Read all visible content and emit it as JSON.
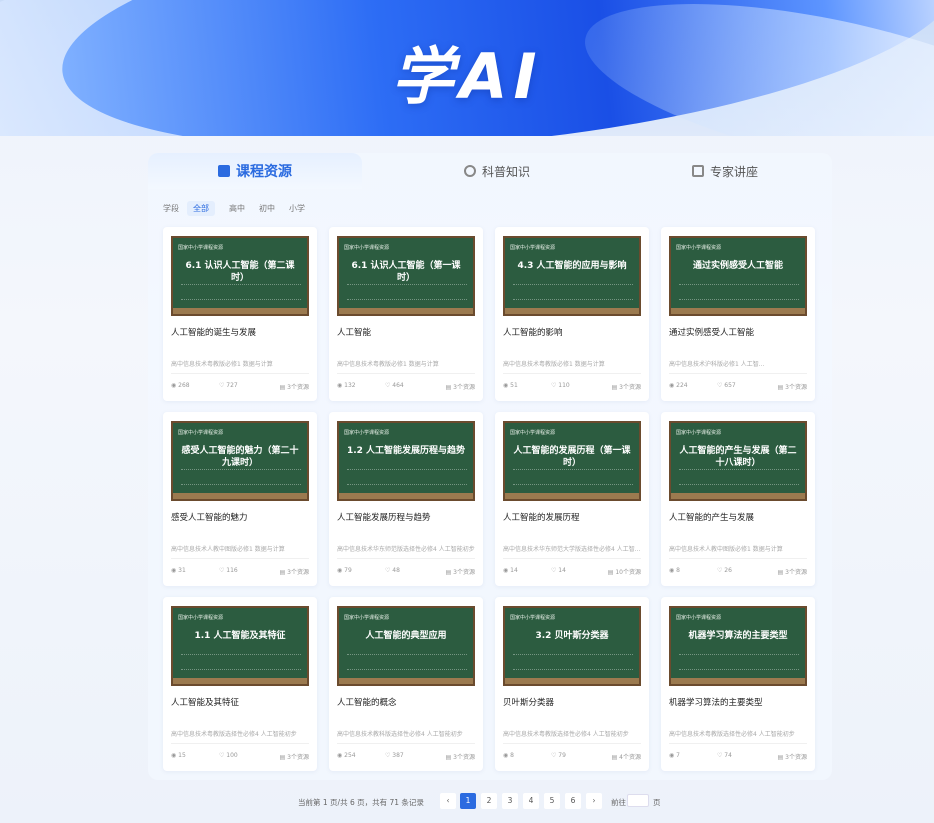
{
  "header": {
    "title": "学AI"
  },
  "tabs": [
    {
      "label": "课程资源",
      "icon": "book-icon",
      "active": true
    },
    {
      "label": "科普知识",
      "icon": "science-icon",
      "active": false
    },
    {
      "label": "专家讲座",
      "icon": "lecture-icon",
      "active": false
    }
  ],
  "filters": {
    "label": "学段",
    "options": [
      "全部",
      "高中",
      "初中",
      "小学"
    ],
    "selected": "全部"
  },
  "cards": [
    {
      "thumb_tag": "国家中小学课程资源",
      "thumb_title": "6.1 认识人工智能（第二课时）",
      "name": "人工智能的诞生与发展",
      "path": "高中信息技术粤教版必修1 数据与计算",
      "views": "268",
      "likes": "727",
      "resources": "3个资源"
    },
    {
      "thumb_tag": "国家中小学课程资源",
      "thumb_title": "6.1 认识人工智能（第一课时）",
      "name": "人工智能",
      "path": "高中信息技术粤教版必修1 数据与计算",
      "views": "132",
      "likes": "464",
      "resources": "3个资源"
    },
    {
      "thumb_tag": "国家中小学课程资源",
      "thumb_title": "4.3 人工智能的应用与影响",
      "name": "人工智能的影响",
      "path": "高中信息技术粤教版必修1 数据与计算",
      "views": "51",
      "likes": "110",
      "resources": "3个资源"
    },
    {
      "thumb_tag": "国家中小学课程资源",
      "thumb_title": "通过实例感受人工智能",
      "name": "通过实例感受人工智能",
      "path": "高中信息技术沪科版必修1 人工智...",
      "views": "224",
      "likes": "657",
      "resources": "3个资源"
    },
    {
      "thumb_tag": "国家中小学课程资源",
      "thumb_title": "感受人工智能的魅力（第二十九课时）",
      "name": "感受人工智能的魅力",
      "path": "高中信息技术人教中图版必修1 数据与计算",
      "views": "31",
      "likes": "116",
      "resources": "3个资源"
    },
    {
      "thumb_tag": "国家中小学课程资源",
      "thumb_title": "1.2 人工智能发展历程与趋势",
      "name": "人工智能发展历程与趋势",
      "path": "高中信息技术华东师范版选择性必修4 人工智能初步",
      "views": "79",
      "likes": "48",
      "resources": "3个资源"
    },
    {
      "thumb_tag": "国家中小学课程资源",
      "thumb_title": "人工智能的发展历程（第一课时）",
      "name": "人工智能的发展历程",
      "path": "高中信息技术华东师范大学版选择性必修4 人工智...",
      "views": "14",
      "likes": "14",
      "resources": "10个资源"
    },
    {
      "thumb_tag": "国家中小学课程资源",
      "thumb_title": "人工智能的产生与发展（第二十八课时）",
      "name": "人工智能的产生与发展",
      "path": "高中信息技术人教中图版必修1 数据与计算",
      "views": "8",
      "likes": "26",
      "resources": "3个资源"
    },
    {
      "thumb_tag": "国家中小学课程资源",
      "thumb_title": "1.1 人工智能及其特征",
      "name": "人工智能及其特征",
      "path": "高中信息技术粤教版选择性必修4 人工智能初步",
      "views": "15",
      "likes": "100",
      "resources": "3个资源"
    },
    {
      "thumb_tag": "国家中小学课程资源",
      "thumb_title": "人工智能的典型应用",
      "name": "人工智能的概念",
      "path": "高中信息技术教科版选择性必修4 人工智能初步",
      "views": "254",
      "likes": "387",
      "resources": "3个资源"
    },
    {
      "thumb_tag": "国家中小学课程资源",
      "thumb_title": "3.2 贝叶斯分类器",
      "name": "贝叶斯分类器",
      "path": "高中信息技术粤教版选择性必修4 人工智能初步",
      "views": "8",
      "likes": "79",
      "resources": "4个资源"
    },
    {
      "thumb_tag": "国家中小学课程资源",
      "thumb_title": "机器学习算法的主要类型",
      "name": "机器学习算法的主要类型",
      "path": "高中信息技术粤教版选择性必修4 人工智能初步",
      "views": "7",
      "likes": "74",
      "resources": "3个资源"
    }
  ],
  "pagination": {
    "info": "当前第 1 页/共 6 页，共有 71 条记录",
    "prev": "‹",
    "pages": [
      "1",
      "2",
      "3",
      "4",
      "5",
      "6"
    ],
    "current": "1",
    "next": "›",
    "goto_label": "前往",
    "page_unit": "页"
  }
}
